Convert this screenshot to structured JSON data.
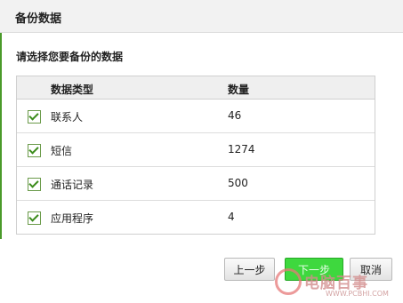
{
  "window": {
    "title": "备份数据"
  },
  "section": {
    "title": "请选择您要备份的数据"
  },
  "table": {
    "headers": {
      "type": "数据类型",
      "count": "数量"
    },
    "rows": [
      {
        "type": "联系人",
        "count": "46",
        "checked": true
      },
      {
        "type": "短信",
        "count": "1274",
        "checked": true
      },
      {
        "type": "通话记录",
        "count": "500",
        "checked": true
      },
      {
        "type": "应用程序",
        "count": "4",
        "checked": true
      }
    ]
  },
  "buttons": {
    "prev": "上一步",
    "next": "下一步",
    "cancel": "取消"
  },
  "watermark": {
    "text": "电脑百事",
    "url": "WWW.PCBHI.COM"
  },
  "colors": {
    "accent_green": "#3ed83e",
    "side_line": "#4a9a2a"
  }
}
